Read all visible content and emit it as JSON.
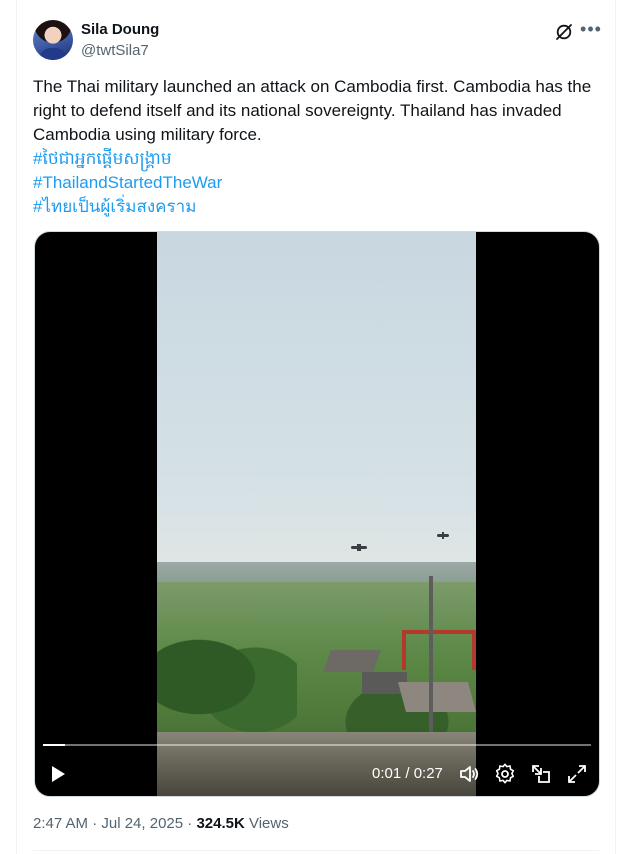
{
  "author": {
    "name": "Sila Doung",
    "handle": "@twtSila7"
  },
  "tweet": {
    "text": "The Thai military launched an attack on Cambodia first. Cambodia has the right to defend itself and its national sovereignty. Thailand has invaded Cambodia using military force.",
    "hashtags": [
      "#ថៃជាអ្នកផ្តើមសង្គ្រាម",
      "#ThailandStartedTheWar",
      "#ไทยเป็นผู้เริ่มสงคราม"
    ]
  },
  "video": {
    "time_display": "0:01 / 0:27",
    "progress": 0.04
  },
  "footer": {
    "timestamp": "2:47 AM · Jul 24, 2025 · ",
    "views_count": "324.5K",
    "views_label": "Views"
  },
  "icons": {
    "header": [
      "grok-icon",
      "more-icon"
    ],
    "video_controls": [
      "play-icon",
      "volume-icon",
      "settings-icon",
      "pip-icon",
      "fullscreen-icon"
    ]
  }
}
